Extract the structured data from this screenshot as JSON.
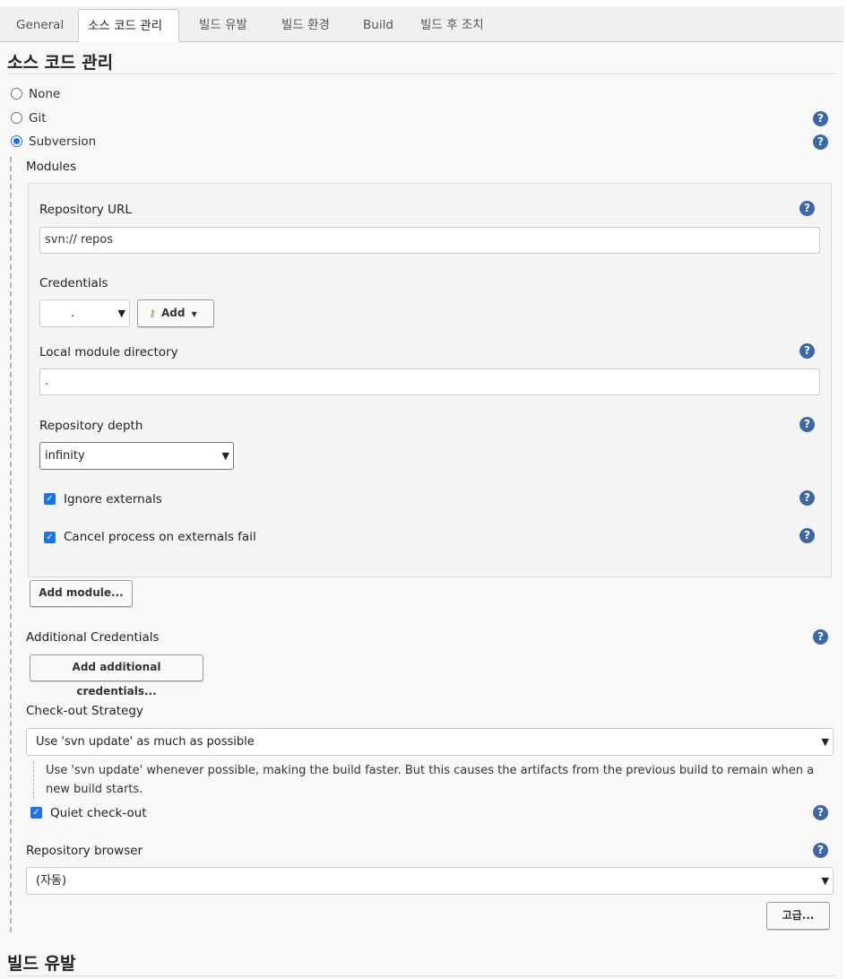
{
  "tabs": [
    {
      "label": "General"
    },
    {
      "label": "소스 코드 관리"
    },
    {
      "label": "빌드 유발"
    },
    {
      "label": "빌드 환경"
    },
    {
      "label": "Build"
    },
    {
      "label": "빌드 후 조치"
    }
  ],
  "scm": {
    "title": "소스 코드 관리",
    "options": [
      "None",
      "Git",
      "Subversion"
    ],
    "selected": "Subversion",
    "modules_label": "Modules",
    "repository_url_label": "Repository URL",
    "repository_url_value": "svn://                    repos",
    "credentials_label": "Credentials",
    "credentials_value": ".",
    "add_label": "Add",
    "local_module_directory_label": "Local module directory",
    "local_module_directory_value": ".",
    "repository_depth_label": "Repository depth",
    "repository_depth_value": "infinity",
    "ignore_externals_label": "Ignore externals",
    "ignore_externals_checked": true,
    "cancel_process_label": "Cancel process on externals fail",
    "cancel_process_checked": true,
    "add_module_label": "Add module...",
    "additional_credentials_label": "Additional Credentials",
    "add_additional_credentials_label": "Add additional credentials...",
    "checkout_strategy_label": "Check-out Strategy",
    "checkout_strategy_value": "Use 'svn update' as much as possible",
    "checkout_strategy_description": "Use 'svn update' whenever possible, making the build faster. But this causes the artifacts from the previous build to remain when a new build starts.",
    "quiet_checkout_label": "Quiet check-out",
    "quiet_checkout_checked": true,
    "repository_browser_label": "Repository browser",
    "repository_browser_value": "(자동)",
    "advanced_label": "고급..."
  },
  "next_section_title": "빌드 유발",
  "colors": {
    "help_icon": "#3d68a8",
    "checkbox": "#1a73e8",
    "panel_bg": "#f8f8f8"
  }
}
